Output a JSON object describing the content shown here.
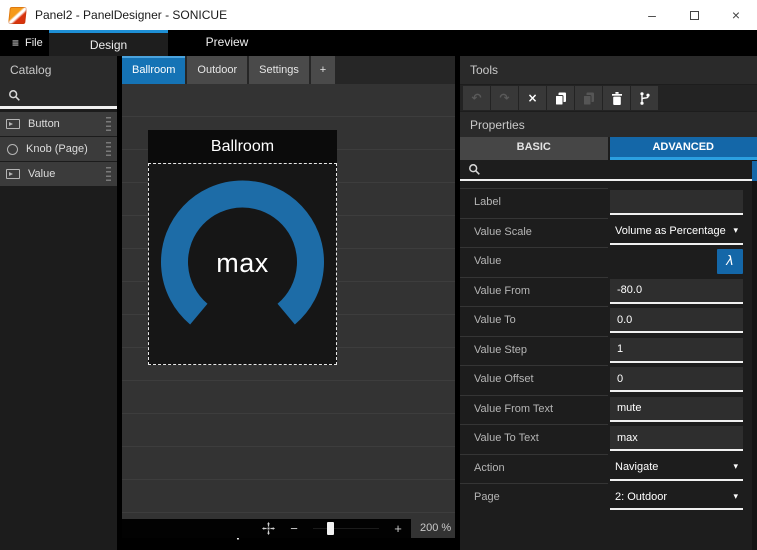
{
  "window": {
    "title": "Panel2 - PanelDesigner - SONICUE",
    "controls": {
      "minimize": "–",
      "maximize": "□",
      "close": "×"
    }
  },
  "menu": {
    "file_icon": "≡",
    "file_label": "File",
    "tabs": [
      {
        "label": "Design",
        "active": true
      },
      {
        "label": "Preview",
        "active": false
      }
    ]
  },
  "catalog": {
    "title": "Catalog",
    "search_value": "",
    "items": [
      {
        "label": "Button",
        "icon": "button-icon"
      },
      {
        "label": "Knob (Page)",
        "icon": "knob-icon"
      },
      {
        "label": "Value",
        "icon": "value-icon"
      }
    ]
  },
  "canvas": {
    "tabs": [
      {
        "label": "Ballroom",
        "active": true
      },
      {
        "label": "Outdoor",
        "active": false
      },
      {
        "label": "Settings",
        "active": false
      },
      {
        "label": "+",
        "active": false
      }
    ],
    "panel": {
      "title": "Ballroom",
      "knob_label": "max",
      "selected": true
    },
    "statusbar": {
      "zoom_out": "−",
      "zoom_in": "+",
      "zoom_level": "200 %"
    }
  },
  "tools": {
    "title": "Tools",
    "buttons": [
      {
        "name": "undo",
        "glyph": "↶",
        "enabled": false
      },
      {
        "name": "redo",
        "glyph": "↷",
        "enabled": false
      },
      {
        "name": "cut",
        "glyph": "×",
        "enabled": true
      },
      {
        "name": "copy",
        "glyph": "copy-pages-icon",
        "enabled": true
      },
      {
        "name": "paste",
        "glyph": "paste-pages-icon",
        "enabled": false
      },
      {
        "name": "delete",
        "glyph": "trash-icon",
        "enabled": true
      },
      {
        "name": "branch",
        "glyph": "branch-icon",
        "enabled": true
      }
    ]
  },
  "properties": {
    "title": "Properties",
    "tabs": [
      {
        "label": "BASIC",
        "active": false
      },
      {
        "label": "ADVANCED",
        "active": true
      }
    ],
    "search_value": "",
    "caret_glyph": "▾",
    "rows": [
      {
        "label": "Label",
        "value": "",
        "type": "input"
      },
      {
        "label": "Value Scale",
        "value": "Volume as Percentage",
        "type": "dropdown"
      },
      {
        "label": "Value",
        "value": "",
        "type": "lambda",
        "button": "λ"
      },
      {
        "label": "Value From",
        "value": "-80.0",
        "type": "input"
      },
      {
        "label": "Value To",
        "value": "0.0",
        "type": "input"
      },
      {
        "label": "Value Step",
        "value": "1",
        "type": "input"
      },
      {
        "label": "Value Offset",
        "value": "0",
        "type": "input"
      },
      {
        "label": "Value From Text",
        "value": "mute",
        "type": "input"
      },
      {
        "label": "Value To Text",
        "value": "max",
        "type": "input"
      },
      {
        "label": "Action",
        "value": "Navigate",
        "type": "dropdown"
      },
      {
        "label": "Page",
        "value": "2: Outdoor",
        "type": "dropdown"
      }
    ]
  },
  "colors": {
    "accent": "#1e8fd5",
    "active_tab_blue": "#1573b5",
    "advanced_tab_blue": "#1467a8",
    "knob_blue": "#1d6ca7"
  }
}
